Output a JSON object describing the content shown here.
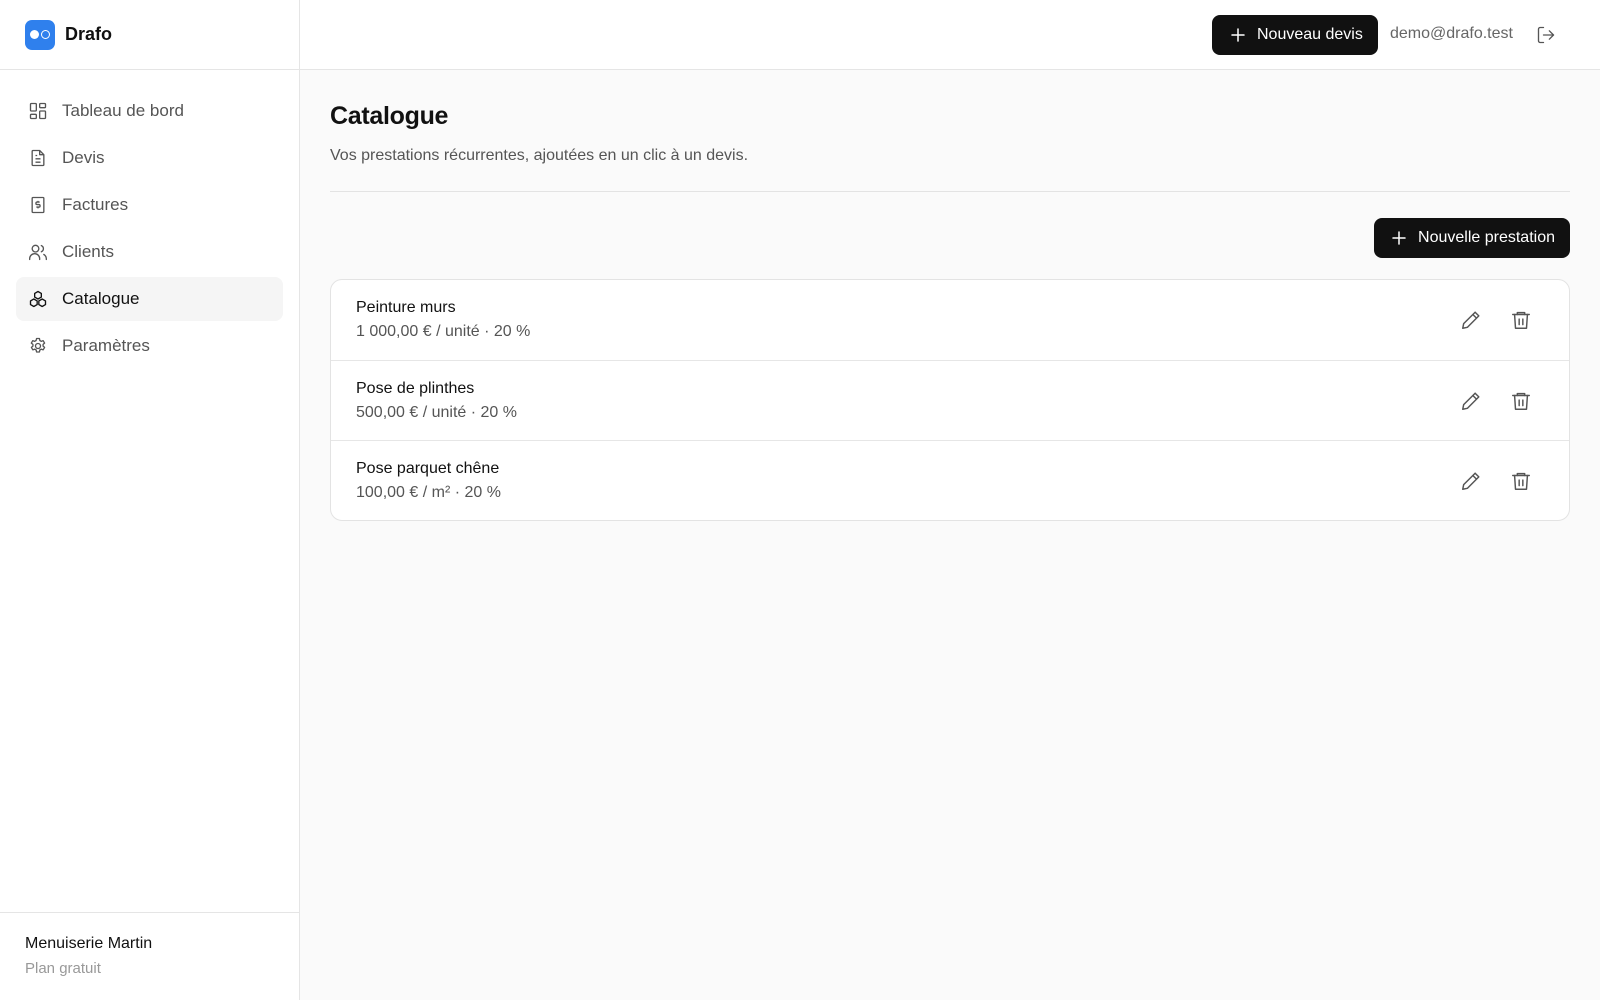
{
  "brand": {
    "name": "Drafo"
  },
  "sidebar": {
    "items": [
      {
        "label": "Tableau de bord",
        "icon": "dashboard-icon",
        "active": false
      },
      {
        "label": "Devis",
        "icon": "document-icon",
        "active": false
      },
      {
        "label": "Factures",
        "icon": "invoice-icon",
        "active": false
      },
      {
        "label": "Clients",
        "icon": "users-icon",
        "active": false
      },
      {
        "label": "Catalogue",
        "icon": "catalog-icon",
        "active": true
      },
      {
        "label": "Paramètres",
        "icon": "gear-icon",
        "active": false
      }
    ],
    "org_name": "Menuiserie Martin",
    "plan": "Plan gratuit"
  },
  "header": {
    "new_quote_label": "Nouveau devis",
    "user_email": "demo@drafo.test"
  },
  "main": {
    "title": "Catalogue",
    "subtitle": "Vos prestations récurrentes, ajoutées en un clic à un devis.",
    "new_item_label": "Nouvelle prestation",
    "items": [
      {
        "name": "Peinture murs",
        "meta": "1 000,00 € / unité · 20 %"
      },
      {
        "name": "Pose de plinthes",
        "meta": "500,00 € / unité · 20 %"
      },
      {
        "name": "Pose parquet chêne",
        "meta": "100,00 € / m² · 20 %"
      }
    ]
  },
  "colors": {
    "brand": "#2f80ed",
    "button_bg": "#111111",
    "active_bg": "#f5f5f5"
  }
}
